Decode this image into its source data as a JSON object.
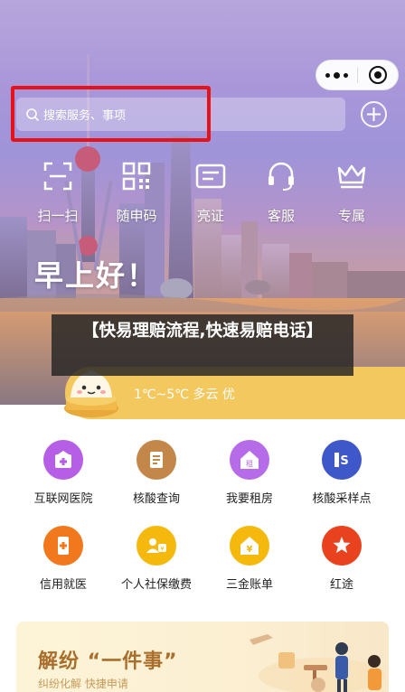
{
  "search": {
    "placeholder": "搜索服务、事项"
  },
  "quick_actions": [
    {
      "label": "扫一扫",
      "icon": "scan-icon"
    },
    {
      "label": "随申码",
      "icon": "qr-code-icon"
    },
    {
      "label": "亮证",
      "icon": "id-card-icon"
    },
    {
      "label": "客服",
      "icon": "headset-icon"
    },
    {
      "label": "专属",
      "icon": "crown-icon"
    }
  ],
  "greeting": "早上好！",
  "banner": {
    "title": "【快易理赔流程,快速易赔电话】"
  },
  "weather": {
    "text": "1℃~5℃ 多云 优"
  },
  "services": [
    {
      "label": "互联网医院",
      "icon": "hospital-icon",
      "color": "#b65ee6"
    },
    {
      "label": "核酸查询",
      "icon": "document-icon",
      "color": "#c4874a"
    },
    {
      "label": "我要租房",
      "icon": "house-icon",
      "color": "#b66be8"
    },
    {
      "label": "核酸采样点",
      "icon": "sampling-icon",
      "color": "#3e58c9"
    },
    {
      "label": "信用就医",
      "icon": "phone-medical-icon",
      "color": "#f2781d"
    },
    {
      "label": "个人社保缴费",
      "icon": "social-security-icon",
      "color": "#f5b90d"
    },
    {
      "label": "三金账单",
      "icon": "yen-house-icon",
      "color": "#f5b90d"
    },
    {
      "label": "红途",
      "icon": "star-flag-icon",
      "color": "#e9421f"
    }
  ],
  "card": {
    "title": "解纷 “一件事”",
    "subtitle": "纠纷化解  快捷申请"
  }
}
